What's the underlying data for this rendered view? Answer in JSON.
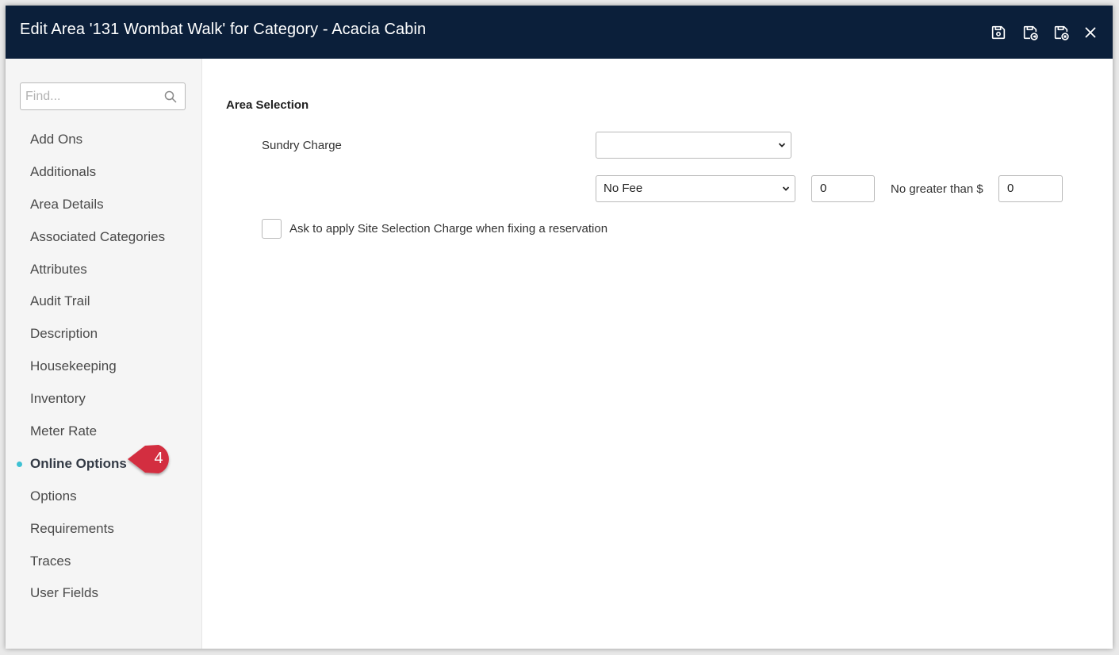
{
  "header": {
    "title": "Edit Area '131 Wombat Walk' for Category - Acacia Cabin",
    "buttons": [
      {
        "icon": "save-icon"
      },
      {
        "icon": "save-and-forward-icon"
      },
      {
        "icon": "save-and-close-icon"
      },
      {
        "icon": "close-icon"
      }
    ]
  },
  "sidebar": {
    "search_placeholder": "Find...",
    "items": [
      {
        "label": "Add Ons"
      },
      {
        "label": "Additionals"
      },
      {
        "label": "Area Details"
      },
      {
        "label": "Associated Categories"
      },
      {
        "label": "Attributes"
      },
      {
        "label": "Audit Trail"
      },
      {
        "label": "Description"
      },
      {
        "label": "Housekeeping"
      },
      {
        "label": "Inventory"
      },
      {
        "label": "Meter Rate"
      },
      {
        "label": "Online Options",
        "active": true
      },
      {
        "label": "Options"
      },
      {
        "label": "Requirements"
      },
      {
        "label": "Traces"
      },
      {
        "label": "User Fields"
      }
    ]
  },
  "callout": {
    "number": "4",
    "color": "#d32f3f"
  },
  "main": {
    "section_title": "Area Selection",
    "sundry_charge_label": "Sundry Charge",
    "sundry_charge_value": "",
    "fee_type_value": "No Fee",
    "fee_amount_value": "0",
    "max_label": "No greater than $",
    "max_value": "0",
    "checkbox_label": "Ask to apply Site Selection Charge when fixing a reservation",
    "checkbox_checked": false
  },
  "colors": {
    "header_bg": "#0b1f3a",
    "active_dot": "#3ec1d3",
    "sidebar_bg": "#f5f5f5"
  }
}
